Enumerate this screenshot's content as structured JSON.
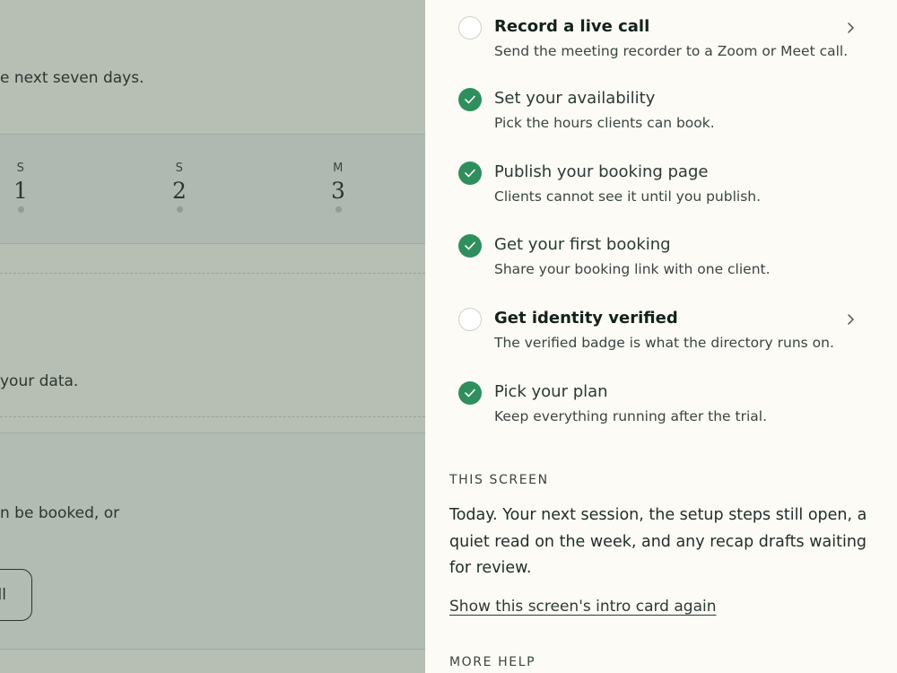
{
  "background": {
    "line_next_days": "e next seven days.",
    "line_data": "your data.",
    "line_booked": "n be booked, or",
    "button_label": "ll",
    "week": [
      {
        "letter": "S",
        "num": "1"
      },
      {
        "letter": "S",
        "num": "2"
      },
      {
        "letter": "M",
        "num": "3"
      }
    ]
  },
  "drawer": {
    "steps": [
      {
        "title": "Record a live call",
        "subtitle": "Send the meeting recorder to a Zoom or Meet call.",
        "done": false,
        "icon": "empty-circle-icon",
        "has_chevron": true
      },
      {
        "title": "Set your availability",
        "subtitle": "Pick the hours clients can book.",
        "done": true,
        "icon": "check-circle-icon"
      },
      {
        "title": "Publish your booking page",
        "subtitle": "Clients cannot see it until you publish.",
        "done": true,
        "icon": "check-circle-icon"
      },
      {
        "title": "Get your first booking",
        "subtitle": "Share your booking link with one client.",
        "done": true,
        "icon": "check-circle-icon"
      },
      {
        "title": "Get identity verified",
        "subtitle": "The verified badge is what the directory runs on.",
        "done": false,
        "icon": "empty-circle-icon",
        "has_chevron": true
      },
      {
        "title": "Pick your plan",
        "subtitle": "Keep everything running after the trial.",
        "done": true,
        "icon": "check-circle-icon"
      }
    ],
    "this_screen_label": "THIS SCREEN",
    "this_screen_text": "Today. Your next session, the setup steps still open, a quiet read on the week, and any recap drafts waiting for review.",
    "intro_link": "Show this screen's intro card again",
    "more_help_label": "MORE HELP"
  },
  "colors": {
    "accent_green": "#2f8f5c",
    "drawer_bg": "#fcfbf6",
    "overlay_bg": "#b7bfb5"
  }
}
